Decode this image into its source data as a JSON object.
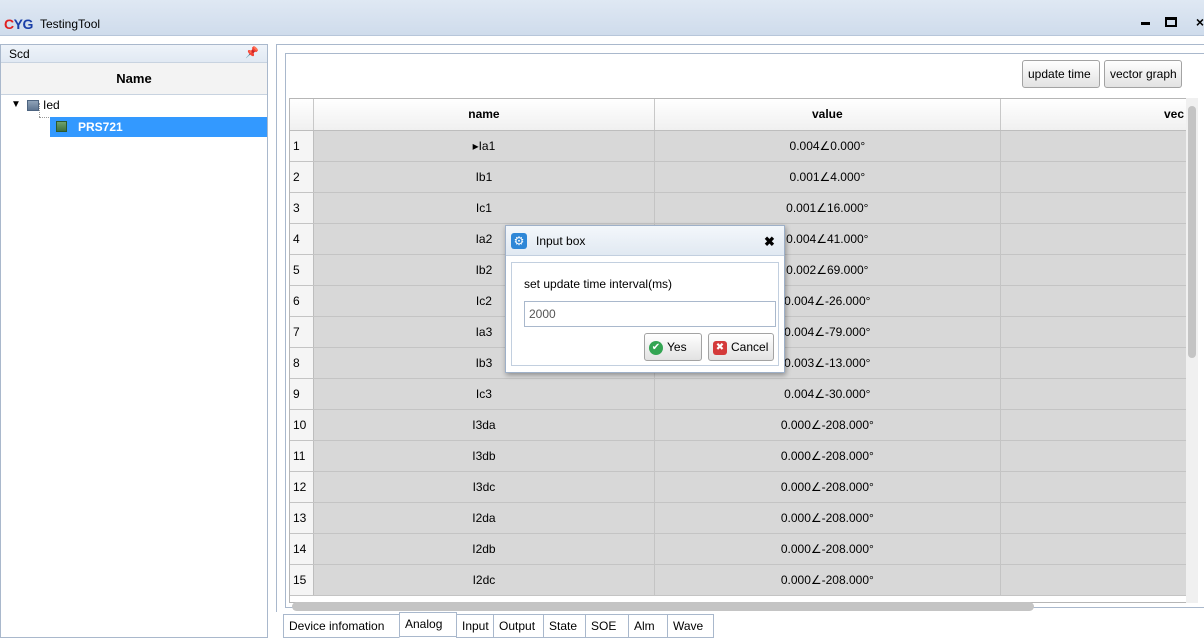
{
  "window": {
    "logo_c": "C",
    "logo_yg": "YG",
    "title": "TestingTool",
    "minimize_glyph": "",
    "maximize_glyph": "",
    "close_glyph": "×"
  },
  "left_panel": {
    "title": "Scd",
    "pin_glyph": "📌",
    "column_header": "Name",
    "tree": [
      {
        "label": "Ied",
        "expanded": true
      },
      {
        "label": "PRS721",
        "selected": true
      }
    ],
    "tree_toggle_glyph": "▼"
  },
  "toolbar": {
    "update_time_label": "update time",
    "vector_graph_label": "vector graph"
  },
  "table": {
    "headers": [
      "name",
      "value",
      "vec"
    ],
    "rows": [
      {
        "n": "1",
        "name": "▸Ia1",
        "value": "0.004∠0.000°"
      },
      {
        "n": "2",
        "name": "Ib1",
        "value": "0.001∠4.000°"
      },
      {
        "n": "3",
        "name": "Ic1",
        "value": "0.001∠16.000°"
      },
      {
        "n": "4",
        "name": "Ia2",
        "value": "0.004∠41.000°"
      },
      {
        "n": "5",
        "name": "Ib2",
        "value": "0.002∠69.000°"
      },
      {
        "n": "6",
        "name": "Ic2",
        "value": "0.004∠-26.000°"
      },
      {
        "n": "7",
        "name": "Ia3",
        "value": "0.004∠-79.000°"
      },
      {
        "n": "8",
        "name": "Ib3",
        "value": "0.003∠-13.000°"
      },
      {
        "n": "9",
        "name": "Ic3",
        "value": "0.004∠-30.000°"
      },
      {
        "n": "10",
        "name": "I3da",
        "value": "0.000∠-208.000°"
      },
      {
        "n": "11",
        "name": "I3db",
        "value": "0.000∠-208.000°"
      },
      {
        "n": "12",
        "name": "I3dc",
        "value": "0.000∠-208.000°"
      },
      {
        "n": "13",
        "name": "I2da",
        "value": "0.000∠-208.000°"
      },
      {
        "n": "14",
        "name": "I2db",
        "value": "0.000∠-208.000°"
      },
      {
        "n": "15",
        "name": "I2dc",
        "value": "0.000∠-208.000°"
      }
    ]
  },
  "tabs": [
    {
      "label": "Device infomation",
      "active": false
    },
    {
      "label": "Analog",
      "active": true
    },
    {
      "label": "Input",
      "active": false
    },
    {
      "label": "Output",
      "active": false
    },
    {
      "label": "State",
      "active": false
    },
    {
      "label": "SOE",
      "active": false
    },
    {
      "label": "Alm",
      "active": false
    },
    {
      "label": "Wave",
      "active": false
    }
  ],
  "dialog": {
    "title": "Input box",
    "close_glyph": "✖",
    "gear_glyph": "⚙",
    "prompt": "set update time interval(ms)",
    "input_value": "2000",
    "yes_label": "Yes",
    "cancel_label": "Cancel",
    "ok_glyph": "✔",
    "cancel_glyph": "✖"
  }
}
